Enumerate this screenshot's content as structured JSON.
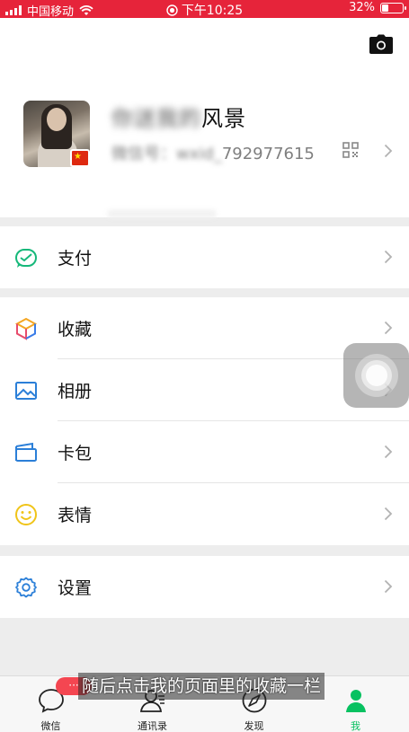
{
  "status_bar": {
    "carrier": "中国移动",
    "time": "下午10:25",
    "battery": "32%",
    "battery_level": 0.32
  },
  "profile": {
    "nickname_obscured": "你送我的",
    "nickname_visible": "风景",
    "wechat_id_label": "微信号：",
    "wechat_id_obscured": "wxid_",
    "wechat_id_visible": "792977615"
  },
  "menu": {
    "pay": "支付",
    "favorites": "收藏",
    "album": "相册",
    "cards": "卡包",
    "stickers": "表情",
    "settings": "设置"
  },
  "tabbar": {
    "chats": "微信",
    "contacts": "通讯录",
    "discover": "发现",
    "me": "我",
    "badge": "···"
  },
  "subtitle": "随后点击我的页面里的收藏一栏",
  "colors": {
    "status_bar": "#e6243a",
    "wechat_green": "#07c160",
    "badge_red": "#f44651"
  }
}
